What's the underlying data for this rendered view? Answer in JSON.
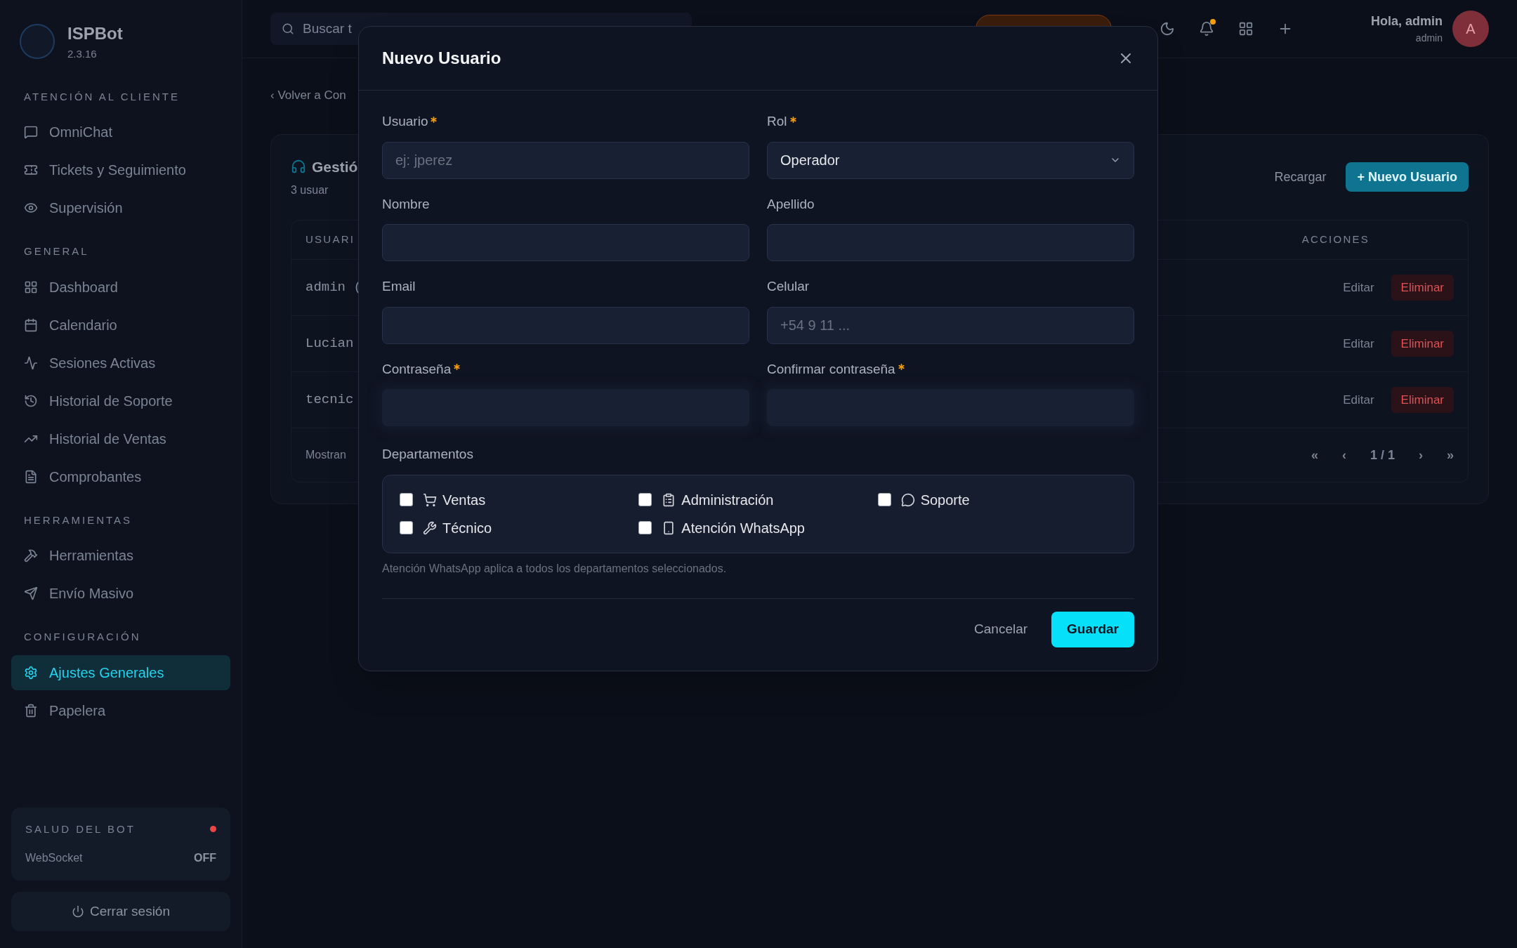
{
  "sidebar": {
    "brand": "ISPBot",
    "version": "2.3.16",
    "sections": [
      {
        "title": "ATENCIÓN AL CLIENTE",
        "items": [
          {
            "label": "OmniChat",
            "selected": false
          },
          {
            "label": "Tickets y Seguimiento",
            "selected": false
          },
          {
            "label": "Supervisión",
            "selected": false
          }
        ]
      },
      {
        "title": "GENERAL",
        "items": [
          {
            "label": "Dashboard",
            "selected": false
          },
          {
            "label": "Calendario",
            "selected": false
          },
          {
            "label": "Sesiones Activas",
            "selected": false
          },
          {
            "label": "Historial de Soporte",
            "selected": false
          },
          {
            "label": "Historial de Ventas",
            "selected": false
          },
          {
            "label": "Comprobantes",
            "selected": false
          }
        ]
      },
      {
        "title": "HERRAMIENTAS",
        "items": [
          {
            "label": "Herramientas",
            "selected": false
          },
          {
            "label": "Envío Masivo",
            "selected": false
          }
        ]
      },
      {
        "title": "CONFIGURACIÓN",
        "items": [
          {
            "label": "Ajustes Generales",
            "selected": true
          },
          {
            "label": "Papelera",
            "selected": false
          }
        ]
      }
    ],
    "health": {
      "title": "SALUD DEL BOT",
      "label": "WebSocket",
      "value": "OFF",
      "color": "#ef4444"
    },
    "logout": "Cerrar sesión"
  },
  "topbar": {
    "search": "Buscar t",
    "greeting": "Hola, admin",
    "role": "admin",
    "avatar": "A"
  },
  "breadcrumb": "‹ Volver a Con",
  "card": {
    "title": "Gestió",
    "subtitle": "3 usuar",
    "reload": "Recargar",
    "new_button": "+ Nuevo Usuario",
    "columns": [
      "USUARI",
      "ACCIONES"
    ],
    "rows": [
      {
        "user": "admin (",
        "edit": "Editar",
        "delete": "Eliminar"
      },
      {
        "user": "Lucian",
        "edit": "Editar",
        "delete": "Eliminar"
      },
      {
        "user": "tecnic",
        "edit": "Editar",
        "delete": "Eliminar"
      }
    ],
    "footer": "Mostran",
    "pagination": [
      "«",
      "‹",
      "1 / 1",
      "›",
      "»"
    ]
  },
  "dialog": {
    "title": "Nuevo Usuario",
    "fields": [
      {
        "kind": "text",
        "label": "Usuario",
        "required": true,
        "placeholder": "ej: jperez"
      },
      {
        "kind": "select",
        "label": "Rol",
        "required": true,
        "value": "Operador"
      },
      {
        "kind": "text",
        "label": "Nombre",
        "required": false
      },
      {
        "kind": "text",
        "label": "Apellido",
        "required": false
      },
      {
        "kind": "text",
        "label": "Email",
        "required": false
      },
      {
        "kind": "text",
        "label": "Celular",
        "required": false,
        "placeholder": "+54 9 11 ..."
      },
      {
        "kind": "password",
        "label": "Contraseña",
        "required": true
      },
      {
        "kind": "password",
        "label": "Confirmar contraseña",
        "required": true
      }
    ],
    "departments_label": "Departamentos",
    "departments": [
      {
        "label": "Ventas",
        "checked": false
      },
      {
        "label": "Administración",
        "checked": false
      },
      {
        "label": "Soporte",
        "checked": false
      },
      {
        "label": "Técnico",
        "checked": false
      },
      {
        "label": "Atención WhatsApp",
        "checked": false
      }
    ],
    "hint": "Atención WhatsApp aplica a todos los departamentos seleccionados.",
    "cancel": "Cancelar",
    "save": "Guardar"
  }
}
